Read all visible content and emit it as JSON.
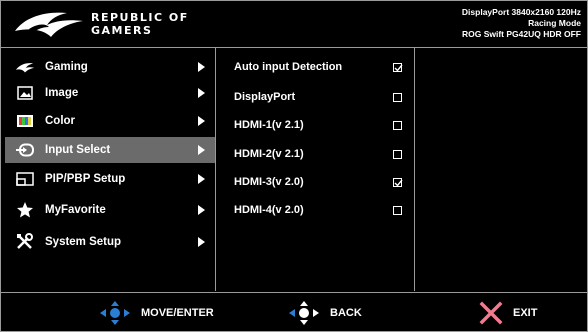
{
  "header": {
    "brand_line1": "REPUBLIC OF",
    "brand_line2": "GAMERS",
    "status_line1": "DisplayPort 3840x2160 120Hz",
    "status_line2": "Racing Mode",
    "status_line3": "ROG Swift PG42UQ HDR OFF"
  },
  "menu": {
    "items": [
      {
        "label": "Gaming",
        "icon": "gaming-icon"
      },
      {
        "label": "Image",
        "icon": "image-icon"
      },
      {
        "label": "Color",
        "icon": "color-icon"
      },
      {
        "label": "Input Select",
        "icon": "input-select-icon",
        "selected": true
      },
      {
        "label": "PIP/PBP Setup",
        "icon": "pip-pbp-icon"
      },
      {
        "label": "MyFavorite",
        "icon": "star-icon"
      },
      {
        "label": "System Setup",
        "icon": "tools-icon"
      }
    ]
  },
  "options": {
    "items": [
      {
        "label": "Auto input Detection",
        "checked": true
      },
      {
        "label": "DisplayPort",
        "checked": false
      },
      {
        "label": "HDMI-1(v 2.1)",
        "checked": false
      },
      {
        "label": "HDMI-2(v 2.1)",
        "checked": false
      },
      {
        "label": "HDMI-3(v 2.0)",
        "checked": true
      },
      {
        "label": "HDMI-4(v 2.0)",
        "checked": false
      }
    ]
  },
  "footer": {
    "move_label": "MOVE/ENTER",
    "back_label": "BACK",
    "exit_label": "EXIT"
  },
  "colors": {
    "background": "#000000",
    "selected_row": "#6b6b6b",
    "nav_blue": "#2a7fd4",
    "exit_pink": "#f07a8e",
    "border": "#9a9a9a"
  }
}
